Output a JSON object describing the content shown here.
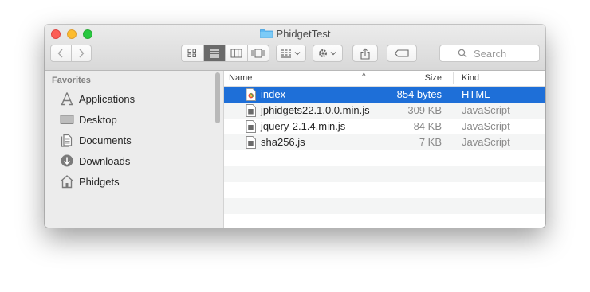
{
  "window": {
    "title": "PhidgetTest",
    "folder_icon": "folder-icon"
  },
  "toolbar": {
    "back_icon": "chevron-left-icon",
    "forward_icon": "chevron-right-icon",
    "view_modes": [
      "icon-view",
      "list-view",
      "column-view",
      "coverflow-view"
    ],
    "active_view": "list-view",
    "search": {
      "placeholder": "Search"
    }
  },
  "sidebar": {
    "heading": "Favorites",
    "items": [
      {
        "label": "Applications",
        "icon": "applications-icon"
      },
      {
        "label": "Desktop",
        "icon": "desktop-icon"
      },
      {
        "label": "Documents",
        "icon": "documents-icon"
      },
      {
        "label": "Downloads",
        "icon": "downloads-icon"
      },
      {
        "label": "Phidgets",
        "icon": "home-icon"
      }
    ]
  },
  "columns": {
    "name": "Name",
    "size": "Size",
    "kind": "Kind"
  },
  "files": [
    {
      "name": "index",
      "size": "854 bytes",
      "kind": "HTML",
      "selected": true
    },
    {
      "name": "jphidgets22.1.0.0.min.js",
      "size": "309 KB",
      "kind": "JavaScript"
    },
    {
      "name": "jquery-2.1.4.min.js",
      "size": "84 KB",
      "kind": "JavaScript"
    },
    {
      "name": "sha256.js",
      "size": "7 KB",
      "kind": "JavaScript"
    }
  ],
  "colors": {
    "selection": "#1e6fd8",
    "sidebar_bg": "#ececec"
  }
}
